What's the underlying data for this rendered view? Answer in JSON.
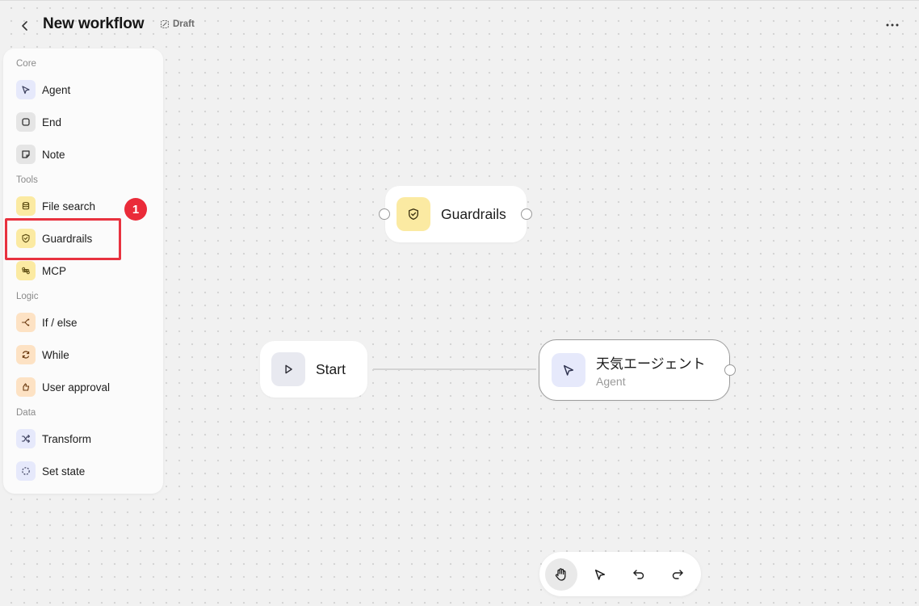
{
  "header": {
    "title": "New workflow",
    "status": "Draft"
  },
  "palette": {
    "sections": {
      "core": "Core",
      "tools": "Tools",
      "logic": "Logic",
      "data": "Data"
    },
    "items": {
      "agent": "Agent",
      "end": "End",
      "note": "Note",
      "file_search": "File search",
      "guardrails": "Guardrails",
      "mcp": "MCP",
      "if_else": "If / else",
      "while": "While",
      "user_approval": "User approval",
      "transform": "Transform",
      "set_state": "Set state"
    }
  },
  "annotation": {
    "step_number": "1"
  },
  "canvas": {
    "nodes": {
      "guardrails": {
        "title": "Guardrails"
      },
      "start": {
        "title": "Start"
      },
      "agent": {
        "title": "天気エージェント",
        "subtitle": "Agent"
      }
    }
  },
  "toolbar": {
    "tools": [
      "hand-icon",
      "pointer-icon",
      "undo-icon",
      "redo-icon"
    ],
    "active_tool": "hand-icon"
  },
  "colors": {
    "highlight": "#e8323f",
    "badge": "#ea2b39",
    "tool_yellow": "#fbeaa2",
    "logic_orange": "#fde2c4",
    "agent_blue": "#e6e9fb"
  }
}
